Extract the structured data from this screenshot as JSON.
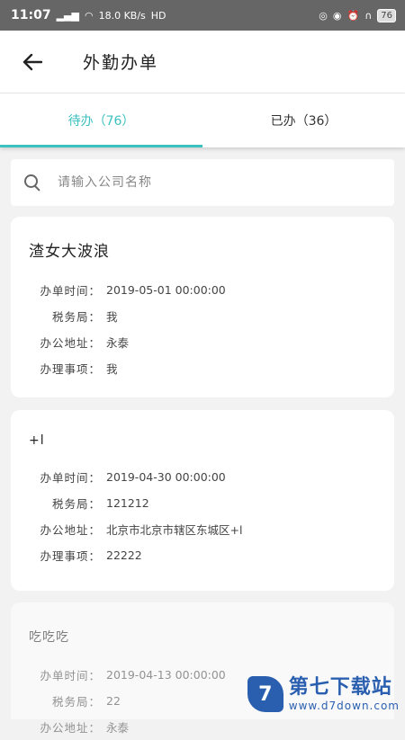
{
  "status_bar": {
    "time": "11:07",
    "network_speed": "18.0 KB/s",
    "hd": "HD",
    "battery": "76"
  },
  "header": {
    "title": "外勤办单"
  },
  "tabs": [
    {
      "label": "待办（76）",
      "active": true
    },
    {
      "label": "已办（36）",
      "active": false
    }
  ],
  "search": {
    "placeholder": "请输入公司名称"
  },
  "labels": {
    "time": "办单时间：",
    "tax_bureau": "税务局：",
    "address": "办公地址：",
    "matter": "办理事项："
  },
  "cards": [
    {
      "title": "渣女大波浪",
      "time": "2019-05-01 00:00:00",
      "tax_bureau": "我",
      "address": "永泰",
      "matter": "我"
    },
    {
      "title": "+l",
      "time": "2019-04-30 00:00:00",
      "tax_bureau": "121212",
      "address": "北京市北京市辖区东城区+l",
      "matter": "22222"
    },
    {
      "title": "吃吃吃",
      "time": "2019-04-13 00:00:00",
      "tax_bureau": "22",
      "address": "永泰",
      "matter": ""
    }
  ],
  "watermark": {
    "name": "第七下载站",
    "url": "www.d7down.com",
    "logo_glyph": "7"
  },
  "colors": {
    "accent": "#3cc0c0",
    "status_bar": "#666666"
  }
}
